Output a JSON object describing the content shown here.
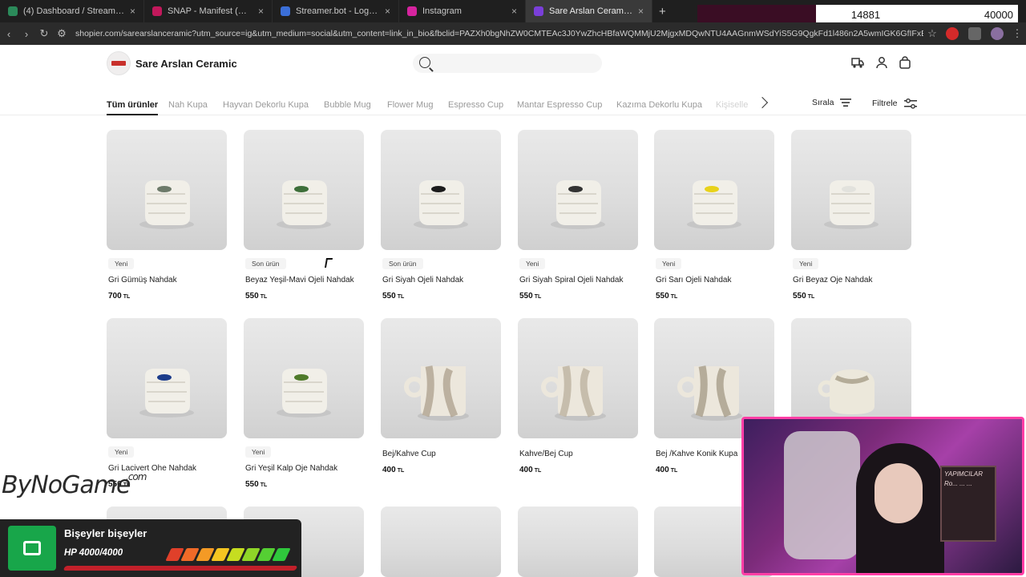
{
  "browser": {
    "tabs": [
      {
        "title": "(4) Dashboard / Streamlabs",
        "color": "#2b8a5a"
      },
      {
        "title": "",
        "color": "#cc2222"
      },
      {
        "title": "SNAP - Manifest (Ai Arabesk Co",
        "color": "#c2185b"
      },
      {
        "title": "Streamer.bot - Logged In",
        "color": "#3b6fd8"
      },
      {
        "title": "Instagram",
        "color": "#d6249f"
      },
      {
        "title": "Sare Arslan Ceramic | Shopier",
        "color": "#7a3fd9"
      }
    ],
    "url": "shopier.com/sarearslanceramic?utm_source=ig&utm_medium=social&utm_content=link_in_bio&fbclid=PAZXh0bgNhZW0CMTEAc3J0YwZhcHBfaWQMMjU2MjgxMDQwNTU4AAGnmWSdYiS5G9QgkFd1l486n2A5wmIGK6GfIFxERs1eaK9vMVKDJNASf...",
    "counter_left": "14881",
    "counter_right": "40000"
  },
  "store": {
    "name": "Sare Arslan Ceramic",
    "search_placeholder": ""
  },
  "categories": [
    "Tüm ürünler",
    "Nah Kupa",
    "Hayvan Dekorlu Kupa",
    "Bubble Mug",
    "Flower Mug",
    "Espresso Cup",
    "Mantar Espresso Cup",
    "Kazıma Dekorlu Kupa",
    "Kişiselle"
  ],
  "toolbar": {
    "sort_label": "Sırala",
    "filter_label": "Filtrele"
  },
  "currency": "TL",
  "products": [
    {
      "badge": "Yeni",
      "name": "Gri Gümüş Nahdak",
      "price": "700",
      "accent": "#6d7a6a",
      "shape": "hand"
    },
    {
      "badge": "Son ürün",
      "name": "Beyaz Yeşil-Mavi Ojeli Nahdak",
      "price": "550",
      "accent": "#3e6f3a",
      "shape": "hand"
    },
    {
      "badge": "Son ürün",
      "name": "Gri Siyah Ojeli Nahdak",
      "price": "550",
      "accent": "#1c1c1c",
      "shape": "hand"
    },
    {
      "badge": "Yeni",
      "name": "Gri Siyah Spiral Ojeli Nahdak",
      "price": "550",
      "accent": "#333333",
      "shape": "hand"
    },
    {
      "badge": "Yeni",
      "name": "Gri Sarı Ojeli Nahdak",
      "price": "550",
      "accent": "#e8d21a",
      "shape": "hand"
    },
    {
      "badge": "Yeni",
      "name": "Gri Beyaz Oje Nahdak",
      "price": "550",
      "accent": "#e2e2dd",
      "shape": "hand"
    },
    {
      "badge": "Yeni",
      "name": "Gri Lacivert Ohe Nahdak",
      "price": "550",
      "accent": "#1c3c8a",
      "shape": "hand"
    },
    {
      "badge": "Yeni",
      "name": "Gri Yeşil Kalp Oje Nahdak",
      "price": "550",
      "accent": "#4f7a2a",
      "shape": "hand"
    },
    {
      "badge": "",
      "name": "Bej/Kahve Cup",
      "price": "400",
      "accent": "#a89a86",
      "shape": "cup"
    },
    {
      "badge": "",
      "name": "Kahve/Bej Cup",
      "price": "400",
      "accent": "#b7ab97",
      "shape": "cup"
    },
    {
      "badge": "",
      "name": "Bej /Kahve Konik Kupa",
      "price": "400",
      "accent": "#9e937e",
      "shape": "cup"
    },
    {
      "badge": "",
      "name": "",
      "price": "",
      "accent": "#b4ac98",
      "shape": "jug"
    }
  ],
  "overlay": {
    "watermark": "ByNoGame",
    "watermark_suffix": ".com",
    "hp_title": "Bişeyler bişeyler",
    "hp_value": "HP 4000/4000",
    "webcam_board": "YAPIMCILAR Ro... ... ..."
  }
}
